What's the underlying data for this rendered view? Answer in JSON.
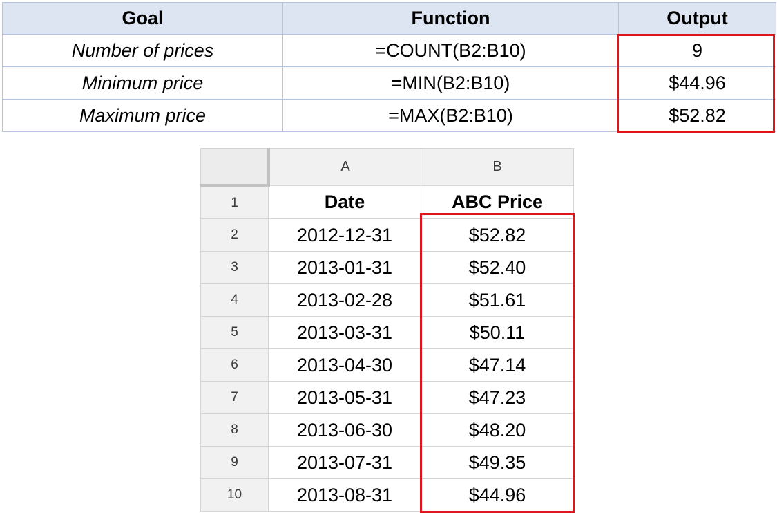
{
  "summary": {
    "headers": {
      "goal": "Goal",
      "function": "Function",
      "output": "Output"
    },
    "rows": [
      {
        "goal": "Number of prices",
        "function": "=COUNT(B2:B10)",
        "output": "9"
      },
      {
        "goal": "Minimum price",
        "function": "=MIN(B2:B10)",
        "output": "$44.96"
      },
      {
        "goal": "Maximum price",
        "function": "=MAX(B2:B10)",
        "output": "$52.82"
      }
    ]
  },
  "sheet": {
    "column_headers": [
      "A",
      "B"
    ],
    "row_numbers": [
      "1",
      "2",
      "3",
      "4",
      "5",
      "6",
      "7",
      "8",
      "9",
      "10"
    ],
    "header_row": {
      "a": "Date",
      "b": "ABC Price"
    },
    "rows": [
      {
        "a": "2012-12-31",
        "b": "$52.82"
      },
      {
        "a": "2013-01-31",
        "b": "$52.40"
      },
      {
        "a": "2013-02-28",
        "b": "$51.61"
      },
      {
        "a": "2013-03-31",
        "b": "$50.11"
      },
      {
        "a": "2013-04-30",
        "b": "$47.14"
      },
      {
        "a": "2013-05-31",
        "b": "$47.23"
      },
      {
        "a": "2013-06-30",
        "b": "$48.20"
      },
      {
        "a": "2013-07-31",
        "b": "$49.35"
      },
      {
        "a": "2013-08-31",
        "b": "$44.96"
      }
    ]
  },
  "colors": {
    "highlight": "#e0151b",
    "summary_header_bg": "#dde5f3",
    "summary_border": "#b4c3e4",
    "sheet_header_bg": "#f1f1f1",
    "sheet_grid": "#d4d4d4"
  }
}
